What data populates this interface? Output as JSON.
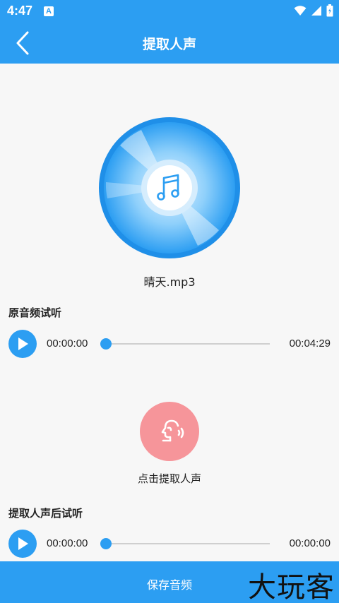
{
  "status_bar": {
    "time": "4:47",
    "notification_icon": "A"
  },
  "header": {
    "title": "提取人声",
    "back_icon": "chevron-left-icon"
  },
  "track": {
    "file_name": "晴天.mp3",
    "disc_icon": "music-note-icon"
  },
  "original_preview": {
    "title": "原音频试听",
    "current_time": "00:00:00",
    "total_time": "00:04:29",
    "progress": 0
  },
  "extract": {
    "label": "点击提取人声",
    "icon": "voice-speaking-icon"
  },
  "extracted_preview": {
    "title": "提取人声后试听",
    "current_time": "00:00:00",
    "total_time": "00:00:00",
    "progress": 0
  },
  "footer": {
    "save_label": "保存音频",
    "watermark": "大玩客"
  },
  "colors": {
    "primary": "#2c9ef2",
    "extract_button": "#f6959a",
    "background": "#f7f7f7"
  }
}
